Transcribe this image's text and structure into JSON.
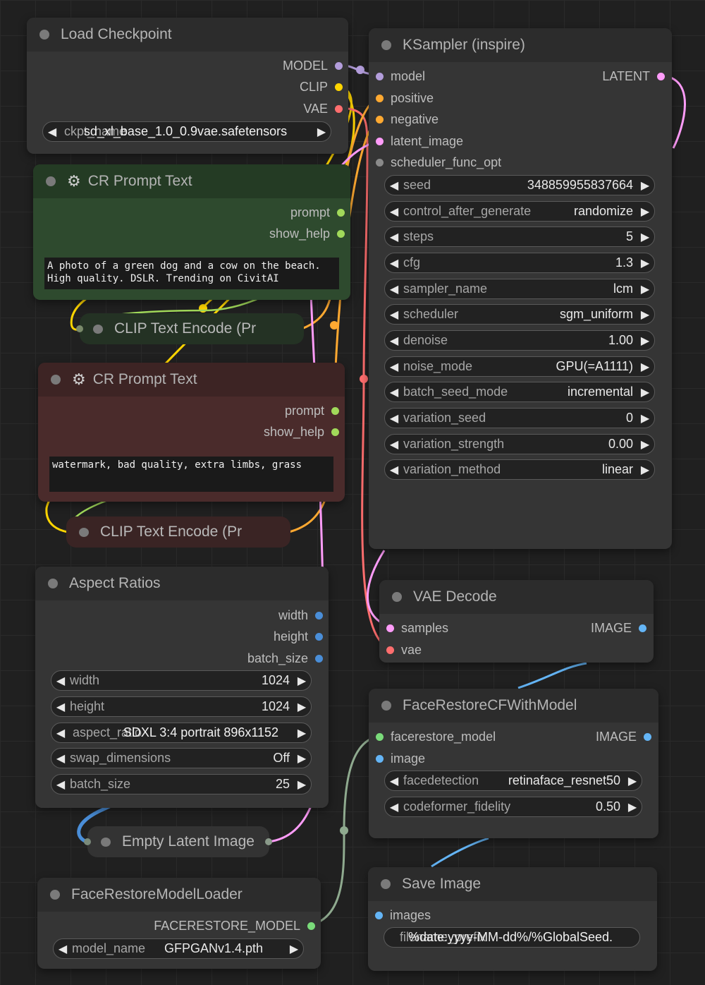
{
  "load_checkpoint": {
    "title": "Load Checkpoint",
    "outputs": [
      "MODEL",
      "CLIP",
      "VAE"
    ],
    "ckpt_label": "ckpt_name",
    "ckpt_value": "sd_xl_base_1.0_0.9vae.safetensors"
  },
  "prompt_positive": {
    "title": "CR Prompt Text",
    "outputs": [
      "prompt",
      "show_help"
    ],
    "text": "A photo of a green dog and a cow on the beach.\nHigh quality. DSLR. Trending on CivitAI"
  },
  "clip_encode_1": {
    "title": "CLIP Text Encode (Pr"
  },
  "prompt_negative": {
    "title": "CR Prompt Text",
    "outputs": [
      "prompt",
      "show_help"
    ],
    "text": "watermark, bad quality, extra limbs, grass"
  },
  "clip_encode_2": {
    "title": "CLIP Text Encode (Pr"
  },
  "aspect_ratios": {
    "title": "Aspect Ratios",
    "outputs": [
      "width",
      "height",
      "batch_size"
    ],
    "widgets": [
      {
        "label": "width",
        "value": "1024"
      },
      {
        "label": "height",
        "value": "1024"
      },
      {
        "label": "aspect_ratio",
        "value": "SDXL 3:4 portrait 896x1152"
      },
      {
        "label": "swap_dimensions",
        "value": "Off"
      },
      {
        "label": "batch_size",
        "value": "25"
      }
    ]
  },
  "empty_latent": {
    "title": "Empty Latent Image"
  },
  "face_restore_loader": {
    "title": "FaceRestoreModelLoader",
    "output": "FACERESTORE_MODEL",
    "model_label": "model_name",
    "model_value": "GFPGANv1.4.pth"
  },
  "ksampler": {
    "title": "KSampler (inspire)",
    "inputs": [
      "model",
      "positive",
      "negative",
      "latent_image",
      "scheduler_func_opt"
    ],
    "output": "LATENT",
    "widgets": [
      {
        "label": "seed",
        "value": "348859955837664"
      },
      {
        "label": "control_after_generate",
        "value": "randomize"
      },
      {
        "label": "steps",
        "value": "5"
      },
      {
        "label": "cfg",
        "value": "1.3"
      },
      {
        "label": "sampler_name",
        "value": "lcm"
      },
      {
        "label": "scheduler",
        "value": "sgm_uniform"
      },
      {
        "label": "denoise",
        "value": "1.00"
      },
      {
        "label": "noise_mode",
        "value": "GPU(=A1111)"
      },
      {
        "label": "batch_seed_mode",
        "value": "incremental"
      },
      {
        "label": "variation_seed",
        "value": "0"
      },
      {
        "label": "variation_strength",
        "value": "0.00"
      },
      {
        "label": "variation_method",
        "value": "linear"
      }
    ]
  },
  "vae_decode": {
    "title": "VAE Decode",
    "inputs": [
      "samples",
      "vae"
    ],
    "output": "IMAGE"
  },
  "face_restore_cf": {
    "title": "FaceRestoreCFWithModel",
    "inputs": [
      "facerestore_model",
      "image"
    ],
    "output": "IMAGE",
    "widgets": [
      {
        "label": "facedetection",
        "value": "retinaface_resnet50"
      },
      {
        "label": "codeformer_fidelity",
        "value": "0.50"
      }
    ]
  },
  "save_image": {
    "title": "Save Image",
    "input": "images",
    "prefix_label": "filename_prefix",
    "prefix_value": "%date:yyyy-MM-dd%/%GlobalSeed."
  },
  "colors": {
    "model": "#b39ddb",
    "clip": "#ffd500",
    "vae": "#ff6e6e",
    "conditioning": "#ffa931",
    "latent": "#ff9cf9",
    "image": "#64b5f6",
    "int": "#4a8ed8",
    "string": "#a1d95a",
    "face_model": "#7adb7a",
    "green_node": "#2e4a2e",
    "red_node": "#4a2b2b"
  }
}
